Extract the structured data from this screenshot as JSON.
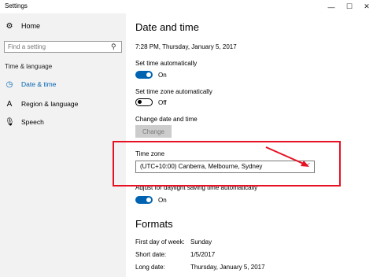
{
  "window": {
    "title": "Settings",
    "controls": {
      "minimize": "—",
      "maximize": "☐",
      "close": "✕"
    }
  },
  "sidebar": {
    "home": {
      "label": "Home",
      "icon": "gear-icon"
    },
    "search": {
      "placeholder": "Find a setting",
      "icon": "search-icon"
    },
    "section_label": "Time & language",
    "items": [
      {
        "label": "Date & time",
        "icon": "calendar-clock-icon",
        "active": true
      },
      {
        "label": "Region & language",
        "icon": "language-icon",
        "active": false
      },
      {
        "label": "Speech",
        "icon": "microphone-icon",
        "active": false
      }
    ]
  },
  "main": {
    "title": "Date and time",
    "current_datetime": "7:28 PM, Thursday, January 5, 2017",
    "set_time_auto": {
      "label": "Set time automatically",
      "state": "On"
    },
    "set_timezone_auto": {
      "label": "Set time zone automatically",
      "state": "Off"
    },
    "change_date_time": {
      "label": "Change date and time",
      "button": "Change"
    },
    "time_zone": {
      "label": "Time zone",
      "value": "(UTC+10:00) Canberra, Melbourne, Sydney"
    },
    "dst": {
      "label": "Adjust for daylight saving time automatically",
      "state": "On"
    },
    "formats": {
      "title": "Formats",
      "rows": [
        {
          "label": "First day of week:",
          "value": "Sunday"
        },
        {
          "label": "Short date:",
          "value": "1/5/2017"
        },
        {
          "label": "Long date:",
          "value": "Thursday, January 5, 2017"
        }
      ]
    }
  },
  "colors": {
    "accent": "#0063b1",
    "highlight_box": "#e81123",
    "sidebar_bg": "#f2f2f2"
  }
}
